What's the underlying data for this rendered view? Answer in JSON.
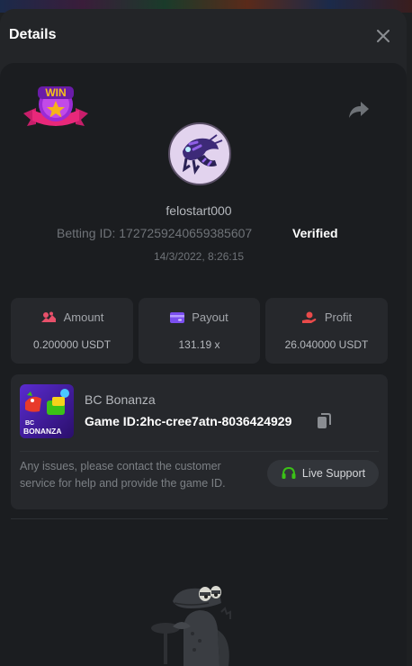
{
  "modal": {
    "title": "Details"
  },
  "player": {
    "username": "felostart000",
    "betting_id_label": "Betting ID:",
    "betting_id": "1727259240659385607",
    "verified_label": "Verified",
    "datetime": "14/3/2022, 8:26:15",
    "badge_text": "WIN"
  },
  "stats": {
    "amount_label": "Amount",
    "amount_value": "0.200000 USDT",
    "payout_label": "Payout",
    "payout_value": "131.19 x",
    "profit_label": "Profit",
    "profit_value": "26.040000 USDT"
  },
  "game": {
    "name": "BC Bonanza",
    "id_label": "Game ID:",
    "id_value": "2hc-cree7atn-8036424929",
    "thumb_text_line1": "BC",
    "thumb_text_line2": "BONANZA"
  },
  "support": {
    "text": "Any issues, please contact the customer service for help and provide the game ID.",
    "button_label": "Live Support"
  },
  "icons": {
    "close": "close-icon",
    "share": "share-icon",
    "amount": "coins-icon",
    "payout": "wallet-icon",
    "profit": "profit-hand-icon",
    "copy": "copy-icon",
    "support": "headset-icon"
  },
  "colors": {
    "accent_green": "#3bc117",
    "amount_icon": "#e8506a",
    "payout_icon": "#7b4ff0",
    "profit_icon": "#e84a4a",
    "badge_gold": "#f6b21a",
    "badge_pink": "#e8287a"
  }
}
